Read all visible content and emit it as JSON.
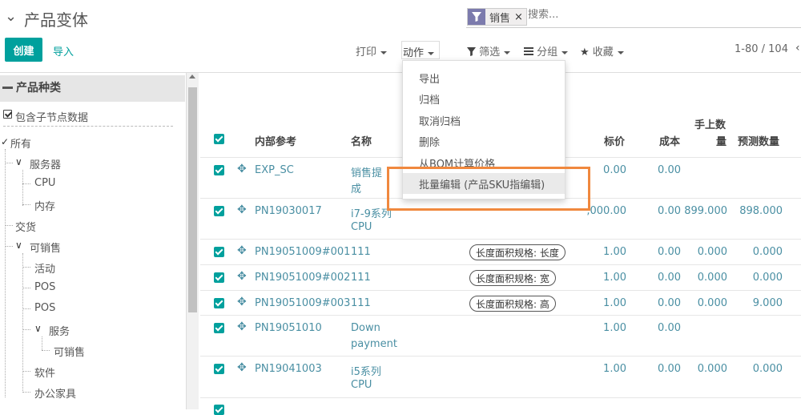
{
  "header": {
    "title_chevron": "⌄",
    "title": "产品变体",
    "search": {
      "facet_icon": "filter-icon",
      "facet_label": "销售",
      "facet_remove": "×",
      "placeholder": "搜索..."
    }
  },
  "toolbar": {
    "create_label": "创建",
    "import_label": "导入",
    "print_label": "打印",
    "action_label": "动作",
    "filter_label": "筛选",
    "group_label": "分组",
    "favorite_label": "收藏",
    "pager": "1-80 / 104",
    "pager_prev": "‹"
  },
  "sidebar": {
    "title": "产品种类",
    "include_children_label": "包含子节点数据",
    "tree": {
      "all": "所有",
      "server": "服务器",
      "cpu": "CPU",
      "memory": "内存",
      "delivery": "交货",
      "saleable": "可销售",
      "activity": "活动",
      "pos1": "POS",
      "pos2": "POS",
      "service": "服务",
      "service_saleable": "可销售",
      "software": "软件",
      "office_furniture": "办公家具"
    }
  },
  "table": {
    "headers": {
      "internal_ref": "内部参考",
      "name": "名称",
      "list_price": "标价",
      "cost": "成本",
      "qty_on_hand_line1": "手上数",
      "qty_on_hand_line2": "量",
      "forecast_qty": "预测数量"
    },
    "rows": [
      {
        "ref": "EXP_SC",
        "name1": "销售提",
        "name2": "成",
        "attr": "",
        "price": "0.00",
        "cost": "0.00",
        "qty": "",
        "forecast": ""
      },
      {
        "ref": "PN19030017",
        "name1": "i7-9系列",
        "name2": "CPU",
        "attr": "",
        "price": ",000.00",
        "cost": "0.00",
        "qty": "899.000",
        "forecast": "898.000"
      },
      {
        "ref": "PN19051009#001",
        "name1": "111",
        "name2": "",
        "attr": "长度面积规格: 长度",
        "price": "1.00",
        "cost": "0.00",
        "qty": "0.000",
        "forecast": "0.000"
      },
      {
        "ref": "PN19051009#002",
        "name1": "111",
        "name2": "",
        "attr": "长度面积规格: 宽",
        "price": "1.00",
        "cost": "0.00",
        "qty": "0.000",
        "forecast": "0.000"
      },
      {
        "ref": "PN19051009#003",
        "name1": "111",
        "name2": "",
        "attr": "长度面积规格: 高",
        "price": "1.00",
        "cost": "0.00",
        "qty": "0.000",
        "forecast": "9.000"
      },
      {
        "ref": "PN19051010",
        "name1": "Down",
        "name2": "payment",
        "attr": "",
        "price": "1.00",
        "cost": "0.00",
        "qty": "",
        "forecast": ""
      },
      {
        "ref": "PN19041003",
        "name1": "i5系列",
        "name2": "CPU",
        "attr": "",
        "price": "1.00",
        "cost": "0.00",
        "qty": "0.000",
        "forecast": "0.000"
      }
    ]
  },
  "action_menu": {
    "items": [
      "导出",
      "归档",
      "取消归档",
      "删除",
      "从BOM计算价格",
      "批量编辑 (产品SKU指编辑)"
    ],
    "highlighted_index": 5
  },
  "colors": {
    "brand": "#00a09d",
    "link": "#4a8fa3",
    "annotation": "#f0883e",
    "facet": "#7c7bad"
  }
}
